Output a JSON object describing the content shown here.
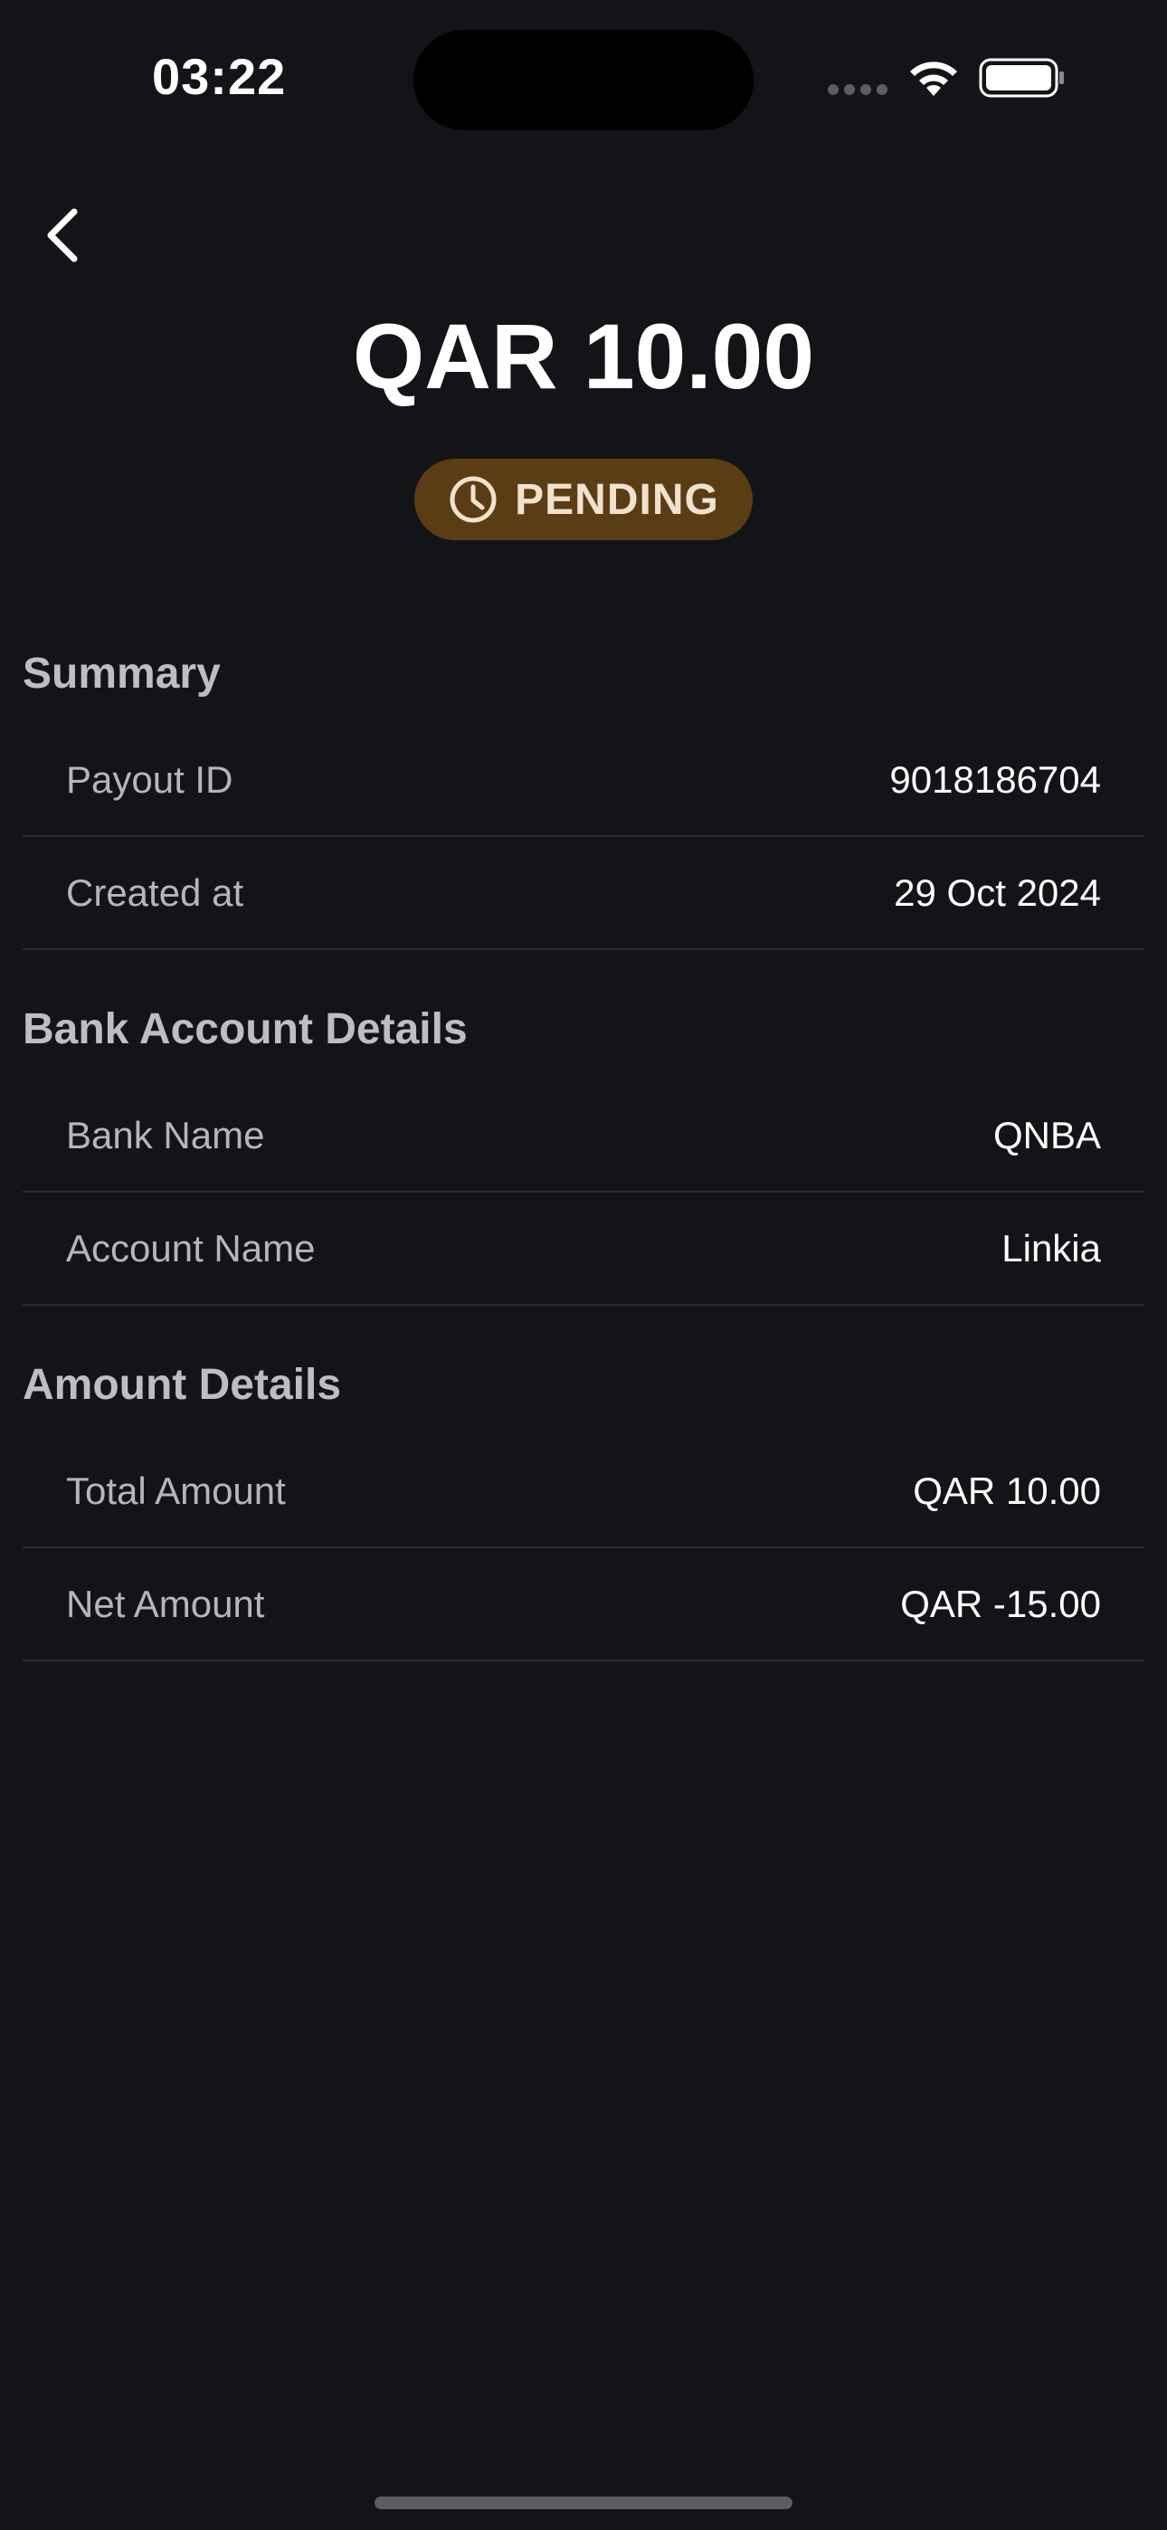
{
  "status_bar": {
    "time": "03:22"
  },
  "header": {
    "amount": "QAR 10.00",
    "status_label": "PENDING"
  },
  "sections": {
    "summary": {
      "title": "Summary",
      "rows": [
        {
          "label": "Payout ID",
          "value": "9018186704"
        },
        {
          "label": "Created at",
          "value": "29 Oct 2024"
        }
      ]
    },
    "bank": {
      "title": "Bank Account Details",
      "rows": [
        {
          "label": "Bank Name",
          "value": "QNBA"
        },
        {
          "label": "Account Name",
          "value": "Linkia"
        }
      ]
    },
    "amount": {
      "title": "Amount Details",
      "rows": [
        {
          "label": "Total Amount",
          "value": "QAR 10.00"
        },
        {
          "label": "Net Amount",
          "value": "QAR -15.00"
        }
      ]
    }
  },
  "colors": {
    "background": "#131418",
    "pending_pill": "#5a3d14",
    "pending_text": "#f0e2cc",
    "section_title": "#bdbec3",
    "divider": "#2a2b30"
  },
  "icons": {
    "back": "chevron-left-icon",
    "status": "clock-icon",
    "signal": "cellular-signal-icon",
    "wifi": "wifi-icon",
    "battery": "battery-icon"
  }
}
